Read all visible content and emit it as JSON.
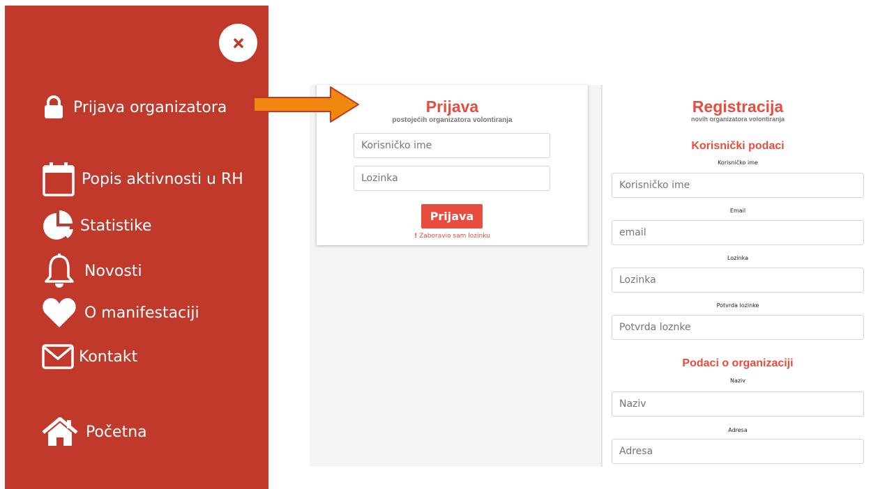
{
  "sidebar": {
    "close_label": "×",
    "items": [
      {
        "label": "Prijava organizatora",
        "icon": "lock-icon"
      },
      {
        "label": "Popis aktivnosti u RH",
        "icon": "calendar-icon"
      },
      {
        "label": "Statistike",
        "icon": "pie-chart-icon"
      },
      {
        "label": "Novosti",
        "icon": "bell-icon"
      },
      {
        "label": "O manifestaciji",
        "icon": "heart-icon"
      },
      {
        "label": "Kontakt",
        "icon": "envelope-icon"
      },
      {
        "label": "Početna",
        "icon": "home-icon"
      }
    ]
  },
  "login": {
    "title": "Prijava",
    "subtitle": "postojećih organizatora volontiranja",
    "username_placeholder": "Korisničko ime",
    "password_placeholder": "Lozinka",
    "button_label": "Prijava",
    "forgot_mark": "!",
    "forgot_label": "Zaboravio sam lozinku"
  },
  "registration": {
    "title": "Registracija",
    "subtitle": "novih organizatora volontiranja",
    "user_section": "Korisnički podaci",
    "org_section": "Podaci o organizaciji",
    "fields": [
      {
        "label": "Korisničko ime",
        "placeholder": "Korisničko ime"
      },
      {
        "label": "Email",
        "placeholder": "email"
      },
      {
        "label": "Lozinka",
        "placeholder": "Lozinka"
      },
      {
        "label": "Potvrda lozinke",
        "placeholder": "Potvrda loznke"
      },
      {
        "label": "Naziv",
        "placeholder": "Naziv"
      },
      {
        "label": "Adresa",
        "placeholder": "Adresa"
      }
    ]
  },
  "colors": {
    "sidebar_bg": "#c0392b",
    "accent": "#e74c3c",
    "arrow_fill": "#f0870f",
    "arrow_stroke": "#c0392b"
  }
}
